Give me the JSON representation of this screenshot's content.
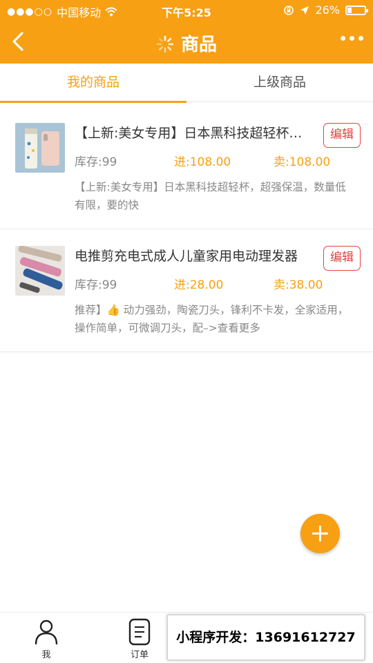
{
  "status_bar": {
    "signal_dots": "●●●○○",
    "carrier": "中国移动",
    "time": "下午5:25",
    "battery_text": "26%",
    "battery_level": 0.26
  },
  "nav": {
    "title": "商品",
    "back_icon": "chevron-left-icon",
    "more_icon": "more-dots-icon"
  },
  "tabs": [
    {
      "label": "我的商品",
      "active": true
    },
    {
      "label": "上级商品",
      "active": false
    }
  ],
  "products": [
    {
      "title": "【上新:美女专用】日本黑科技超轻杯…",
      "edit_label": "编辑",
      "stock": "库存:99",
      "buy": "进:108.00",
      "sell": "卖:108.00",
      "desc": "【上新:美女专用】日本黑科技超轻杯，超强保温，数量低有限，要的快"
    },
    {
      "title": "电推剪充电式成人儿童家用电动理发器",
      "edit_label": "编辑",
      "stock": "库存:99",
      "buy": "进:28.00",
      "sell": "卖:38.00",
      "desc": "推荐】👍 动力强劲，陶瓷刀头，锋利不卡发，全家适用，操作简单，可微调刀头，配–>查看更多"
    }
  ],
  "tabbar": {
    "me_label": "我",
    "orders_label": "订单"
  },
  "promo_text": "小程序开发：13691612727",
  "colors": {
    "accent": "#f7a013",
    "edit_red": "#e2423d"
  }
}
